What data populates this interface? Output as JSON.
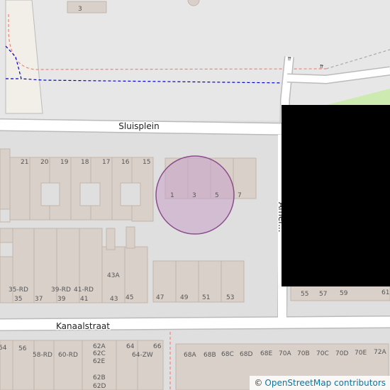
{
  "map": {
    "streets": {
      "sluisplein": "Sluisplein",
      "kanaalstraat": "Kanaalstraat",
      "vertical_partial": "Amer..."
    },
    "house_numbers": {
      "top_3": "3",
      "row_top": [
        "21",
        "20",
        "19",
        "18",
        "17",
        "16",
        "15"
      ],
      "highlight_row": [
        "1",
        "3",
        "5",
        "7"
      ],
      "mid_left": [
        "35-RD",
        "39-RD",
        "41-RD",
        "43A"
      ],
      "mid_bottom": [
        "35",
        "37",
        "39",
        "41",
        "43",
        "45"
      ],
      "right_row": [
        "47",
        "49",
        "51",
        "53"
      ],
      "far_right": [
        "55",
        "57",
        "59",
        "61"
      ],
      "bottom_left": [
        "64",
        "56",
        "58-RD",
        "60-RD",
        "62A",
        "62C",
        "62E",
        "62B",
        "62D",
        "64",
        "64-ZW",
        "66"
      ],
      "bottom_right": [
        "68A",
        "68B",
        "68C",
        "68D",
        "68E",
        "70A",
        "70B",
        "70C",
        "70D",
        "70E",
        "72A"
      ]
    },
    "highlight_color": "#c8a0c8",
    "highlight_stroke": "#8b4d8b"
  },
  "attribution": {
    "symbol": "©",
    "link_text": "OpenStreetMap contributors"
  }
}
